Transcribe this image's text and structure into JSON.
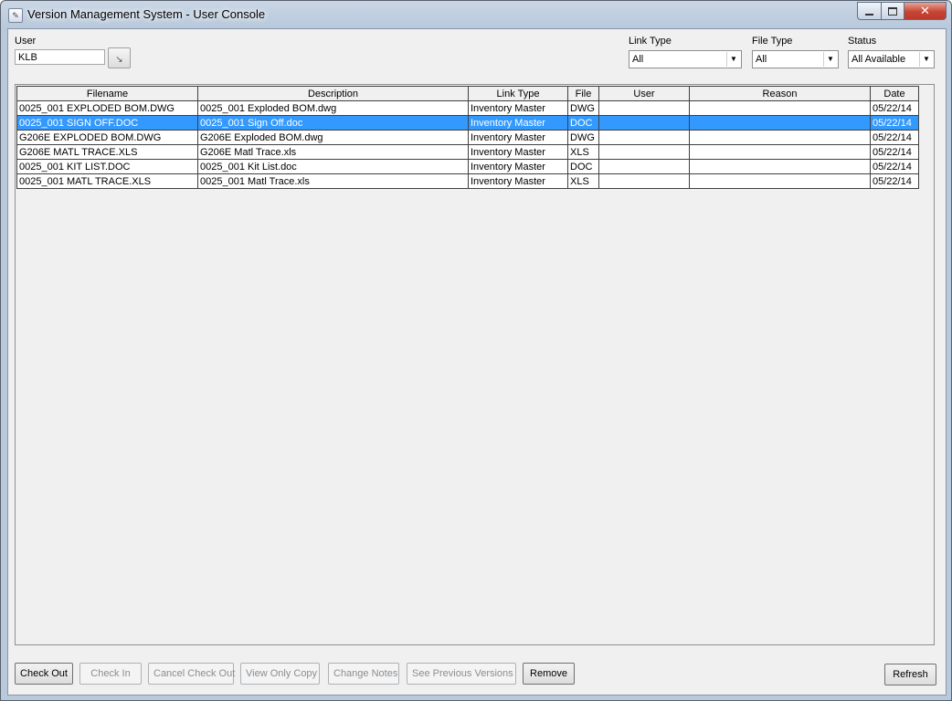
{
  "window": {
    "title": "Version Management System - User Console"
  },
  "filters": {
    "user_label": "User",
    "user_value": "KLB",
    "lookup_glyph": "↘",
    "link_type_label": "Link Type",
    "link_type_value": "All",
    "file_type_label": "File Type",
    "file_type_value": "All",
    "status_label": "Status",
    "status_value": "All Available"
  },
  "grid": {
    "columns": [
      "Filename",
      "Description",
      "Link Type",
      "File",
      "User",
      "Reason",
      "Date"
    ],
    "rows": [
      [
        "0025_001 EXPLODED BOM.DWG",
        "0025_001 Exploded BOM.dwg",
        "Inventory Master",
        "DWG",
        "",
        "",
        "05/22/14"
      ],
      [
        "0025_001 SIGN OFF.DOC",
        "0025_001 Sign Off.doc",
        "Inventory Master",
        "DOC",
        "",
        "",
        "05/22/14"
      ],
      [
        "G206E EXPLODED BOM.DWG",
        "G206E Exploded BOM.dwg",
        "Inventory Master",
        "DWG",
        "",
        "",
        "05/22/14"
      ],
      [
        "G206E MATL TRACE.XLS",
        "G206E Matl Trace.xls",
        "Inventory Master",
        "XLS",
        "",
        "",
        "05/22/14"
      ],
      [
        "0025_001 KIT LIST.DOC",
        "0025_001 Kit List.doc",
        "Inventory Master",
        "DOC",
        "",
        "",
        "05/22/14"
      ],
      [
        "0025_001 MATL TRACE.XLS",
        "0025_001 Matl Trace.xls",
        "Inventory Master",
        "XLS",
        "",
        "",
        "05/22/14"
      ]
    ],
    "selected_row": 1
  },
  "buttons": {
    "check_out": "Check Out",
    "check_in": "Check In",
    "cancel_check_out": "Cancel Check Out",
    "view_only_copy": "View Only Copy",
    "change_notes": "Change Notes",
    "see_previous_versions": "See Previous Versions",
    "remove": "Remove",
    "refresh": "Refresh"
  },
  "icons": {
    "app": "app-icon",
    "minimize": "minimize-icon",
    "maximize": "maximize-icon",
    "close": "close-icon",
    "lookup": "lookup-icon",
    "dropdown": "chevron-down-icon"
  },
  "colors": {
    "selection": "#3399ff",
    "close_button": "#c74433",
    "title_bar": "#c9d6e5"
  }
}
